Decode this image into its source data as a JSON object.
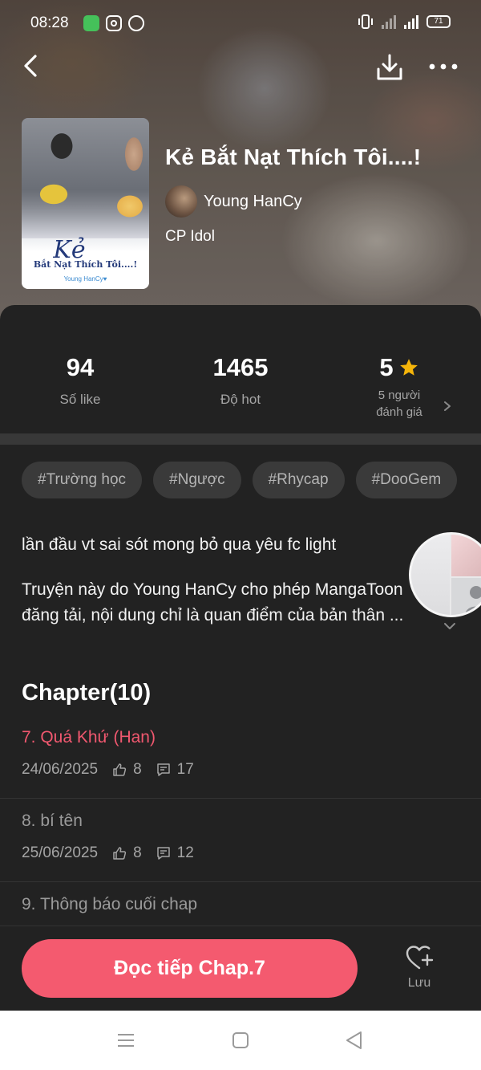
{
  "status_bar": {
    "time": "08:28",
    "battery": "71"
  },
  "story": {
    "title": "Kẻ Bắt Nạt Thích Tôi....!",
    "author": "Young HanCy",
    "category": "CP Idol",
    "cover": {
      "title_big": "Kẻ",
      "title_small": "Bắt Nạt Thích Tôi....!",
      "author": "Young HanCy♥"
    }
  },
  "stats": {
    "likes_value": "94",
    "likes_label": "Số like",
    "hot_value": "1465",
    "hot_label": "Độ hot",
    "rating_value": "5",
    "rating_label_line1": "5 người",
    "rating_label_line2": "đánh giá"
  },
  "tags": [
    "#Trường học",
    "#Ngược",
    "#Rhycap",
    "#DooGem"
  ],
  "description": {
    "line1": "lần đầu vt sai sót mong bỏ qua yêu fc light",
    "line2": "Truyện này do Young HanCy cho phép MangaToon",
    "line3": "đăng tải, nội dung chỉ là quan điểm của bản thân ..."
  },
  "chapters": {
    "heading": "Chapter(10)",
    "items": [
      {
        "name": "7. Quá Khứ (Han)",
        "date": "24/06/2025",
        "likes": "8",
        "comments": "17",
        "current": true
      },
      {
        "name": "8. bí tên",
        "date": "25/06/2025",
        "likes": "8",
        "comments": "12",
        "current": false
      },
      {
        "name": "9. Thông báo cuối chap",
        "date": "",
        "likes": "",
        "comments": "",
        "current": false
      }
    ]
  },
  "actions": {
    "read_label": "Đọc tiếp Chap.7",
    "save_label": "Lưu"
  },
  "colors": {
    "accent": "#f45a6f",
    "current_chapter": "#f0586f",
    "background": "#222222",
    "star": "#f5b50a"
  },
  "icons": [
    "back-icon",
    "download-icon",
    "more-icon",
    "star-icon",
    "chevron-right-icon",
    "chevron-down-icon",
    "thumb-up-icon",
    "comment-icon",
    "heart-plus-icon",
    "menu-icon",
    "home-square-icon",
    "back-triangle-icon"
  ]
}
